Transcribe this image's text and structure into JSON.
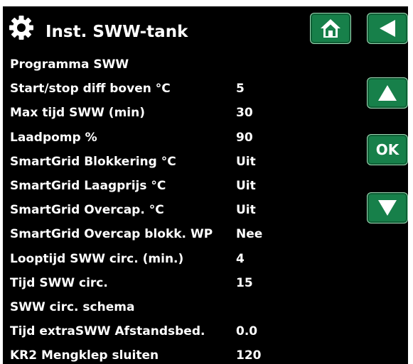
{
  "header": {
    "title": "Inst. SWW-tank",
    "title_icon": "gear-icon",
    "home_icon": "home-icon",
    "back_icon": "back-arrow-icon"
  },
  "nav": {
    "up_icon": "up-arrow-icon",
    "ok_label": "OK",
    "down_icon": "down-arrow-icon"
  },
  "colors": {
    "background": "#000000",
    "text": "#ffffff",
    "button": "#17804a"
  },
  "settings": [
    {
      "label": "Programma SWW",
      "value": ""
    },
    {
      "label": "Start/stop diff boven °C",
      "value": "5"
    },
    {
      "label": "Max tijd SWW (min)",
      "value": "30"
    },
    {
      "label": "Laadpomp %",
      "value": "90"
    },
    {
      "label": "SmartGrid Blokkering °C",
      "value": "Uit"
    },
    {
      "label": "SmartGrid Laagprijs °C",
      "value": "Uit"
    },
    {
      "label": "SmartGrid Overcap. °C",
      "value": "Uit"
    },
    {
      "label": "SmartGrid Overcap blokk. WP",
      "value": "Nee"
    },
    {
      "label": "Looptijd SWW circ. (min.)",
      "value": "4"
    },
    {
      "label": "Tijd SWW circ.",
      "value": "15"
    },
    {
      "label": "SWW circ. schema",
      "value": ""
    },
    {
      "label": "Tijd extraSWW Afstandsbed.",
      "value": "0.0"
    },
    {
      "label": "KR2 Mengklep sluiten",
      "value": "120"
    }
  ]
}
